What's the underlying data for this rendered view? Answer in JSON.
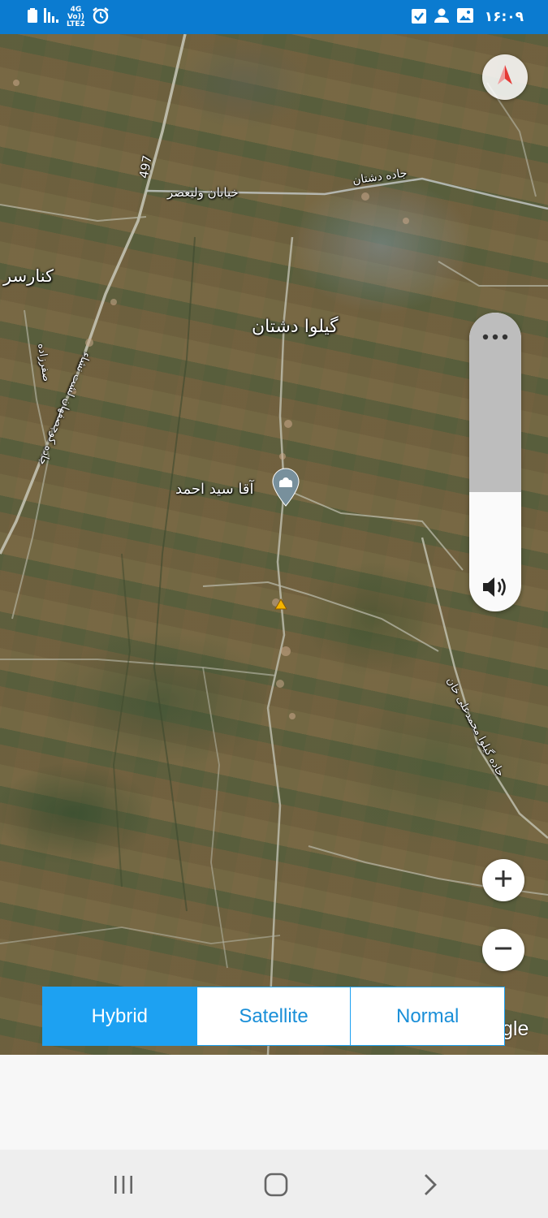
{
  "status_bar": {
    "network_top": "4G",
    "network_bottom_1": "Vo))",
    "network_bottom_2": "LTE2",
    "time": "۱۶:۰۹",
    "icons": [
      "battery-icon",
      "signal-icon",
      "alarm-icon",
      "task-check-icon",
      "person-icon",
      "image-icon"
    ]
  },
  "map": {
    "labels": {
      "road_497": "497",
      "vali_asr": "خیابان ولیعصر",
      "jadeh_dashtan": "جاده دشتان",
      "konarsar": "کنارسر",
      "gilva_dashtan": "گیلوا دشتان",
      "safarzadeh": "صفرزاده",
      "jadeh_kuchesfahan": "جاده کوچصفهان لشت نشاء",
      "aqa_seyed_ahmad": "آقا سید احمد",
      "jadeh_gilva": "جاده گیلوا محمدعلی خان"
    },
    "icons": [
      "compass-icon",
      "mosque-pin-icon",
      "location-marker-icon"
    ],
    "attribution": "gle"
  },
  "volume": {
    "level_percent": 40,
    "menu_icon": "more-dots-icon",
    "speaker_icon": "speaker-icon"
  },
  "zoom": {
    "in_icon": "plus-icon",
    "out_icon": "minus-icon"
  },
  "map_type": {
    "options": [
      "Hybrid",
      "Satellite",
      "Normal"
    ],
    "selected": "Hybrid"
  },
  "nav_bar": {
    "icons": [
      "recent-apps-icon",
      "home-icon",
      "back-icon"
    ]
  }
}
